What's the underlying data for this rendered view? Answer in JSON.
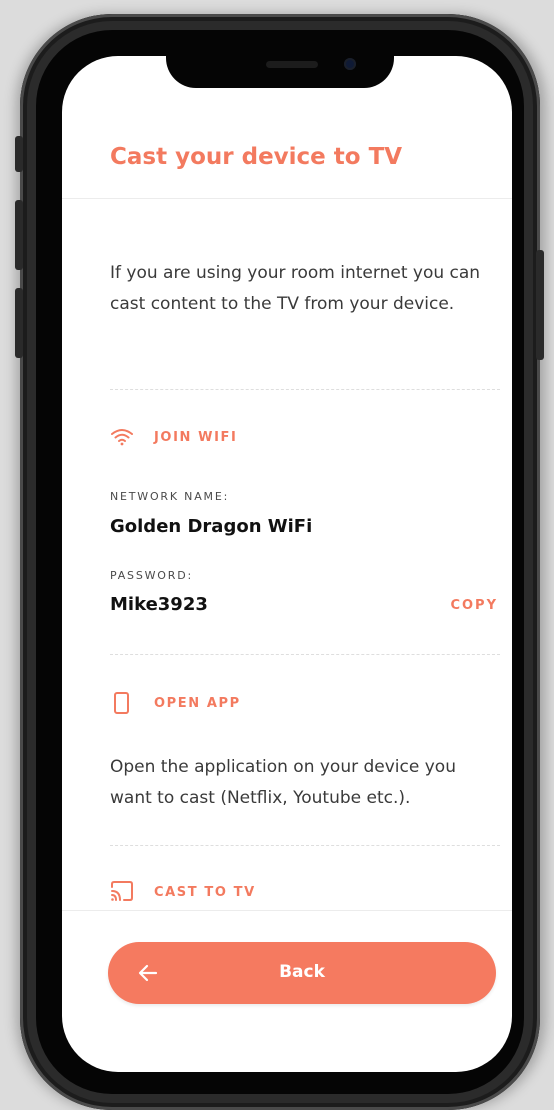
{
  "header": {
    "title": "Cast your device to TV"
  },
  "intro": {
    "text": "If you are using your room internet you can cast content to the TV from your device."
  },
  "wifi": {
    "heading": "JOIN WIFI",
    "icon": "wifi-icon",
    "network_label": "NETWORK NAME:",
    "network_name": "Golden Dragon WiFi",
    "password_label": "PASSWORD:",
    "password": "Mike3923",
    "copy_label": "COPY"
  },
  "open_app": {
    "heading": "OPEN APP",
    "icon": "phone-icon",
    "text": "Open the application on your device you want to cast (Netflix, Youtube etc.)."
  },
  "cast": {
    "heading": "CAST TO TV",
    "icon": "cast-icon"
  },
  "footer": {
    "back_label": "Back",
    "back_icon": "arrow-left-icon"
  },
  "colors": {
    "accent": "#f37a5f",
    "button": "#f57a60",
    "text": "#3a3a3a"
  }
}
